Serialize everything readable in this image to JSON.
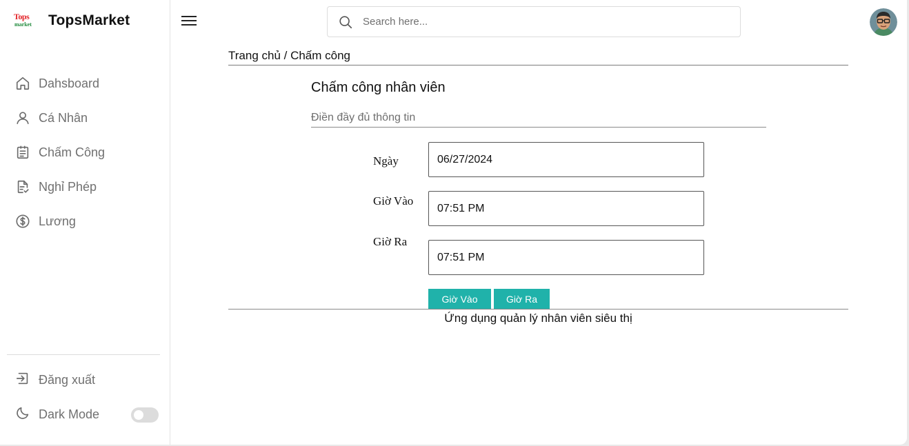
{
  "brand": {
    "logo_top": "Tops",
    "logo_bottom": "market",
    "name": "TopsMarket"
  },
  "sidebar": {
    "items": [
      {
        "label": "Dahsboard",
        "icon": "home-icon"
      },
      {
        "label": "Cá Nhân",
        "icon": "user-icon"
      },
      {
        "label": "Chấm Công",
        "icon": "clipboard-icon"
      },
      {
        "label": "Nghỉ Phép",
        "icon": "document-check-icon"
      },
      {
        "label": "Lương",
        "icon": "dollar-circle-icon"
      }
    ],
    "logout_label": "Đăng xuất",
    "dark_mode_label": "Dark Mode",
    "dark_mode_on": false
  },
  "header": {
    "search_placeholder": "Search here..."
  },
  "breadcrumb": "Trang chủ / Chấm công",
  "form": {
    "title": "Chấm công nhân viên",
    "subtitle": "Điền đầy đủ thông tin",
    "date_label": "Ngày",
    "date_value": "06/27/2024",
    "in_label": "Giờ Vào",
    "in_value": "07:51 PM",
    "out_label": "Giờ Ra",
    "out_value": "07:51 PM",
    "btn_in": "Giờ Vào",
    "btn_out": "Giờ Ra"
  },
  "footer": "Ứng dụng quản lý nhân viên siêu thị",
  "colors": {
    "accent": "#20b2aa",
    "text_muted": "#707070"
  }
}
